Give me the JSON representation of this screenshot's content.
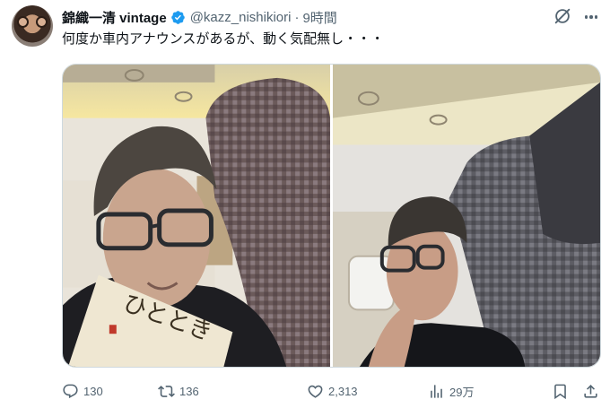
{
  "tweet": {
    "display_name": "錦織一清 vintage",
    "handle": "@kazz_nishikiori",
    "separator": "·",
    "time": "9時間",
    "text": "何度か車内アナウンスがあるが、動く気配無し・・・"
  },
  "photos": [
    {
      "book_title": "ひととき"
    },
    {}
  ],
  "actions": {
    "replies": "130",
    "reposts": "136",
    "likes": "2,313",
    "views": "29万"
  },
  "icons": {
    "verified": "verified-badge-icon",
    "grok": "grok-icon",
    "more": "more-icon",
    "reply": "reply-icon",
    "repost": "repost-icon",
    "like": "like-icon",
    "views": "views-icon",
    "bookmark": "bookmark-icon",
    "share": "share-icon"
  },
  "colors": {
    "verified": "#1d9bf0",
    "secondary_text": "#536471",
    "text": "#0f1419"
  }
}
